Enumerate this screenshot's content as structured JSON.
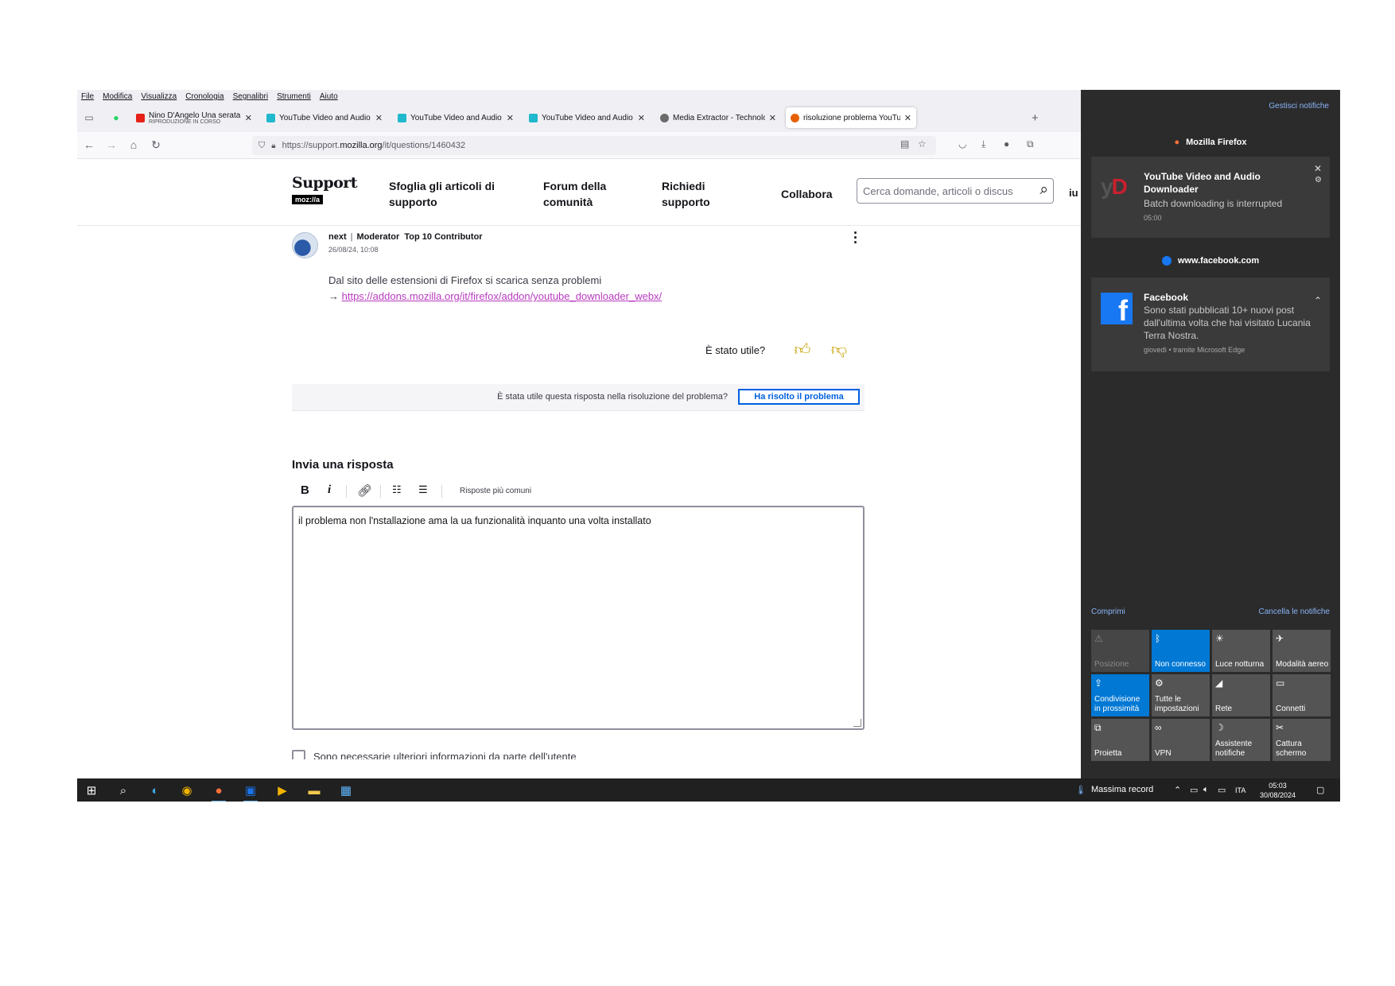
{
  "menu": [
    "File",
    "Modifica",
    "Visualizza",
    "Cronologia",
    "Segnalibri",
    "Strumenti",
    "Aiuto"
  ],
  "tabs": [
    {
      "title": "Nino D'Angelo Una serata parti",
      "subtitle": "RIPRODUZIONE IN CORSO",
      "color": "#e62117",
      "active": false
    },
    {
      "title": "YouTube Video and Audio Dow",
      "color": "#1fb8cd",
      "active": false
    },
    {
      "title": "YouTube Video and Audio Dow",
      "color": "#1fb8cd",
      "active": false
    },
    {
      "title": "YouTube Video and Audio Dow",
      "color": "#1fb8cd",
      "active": false
    },
    {
      "title": "Media Extractor - TechnologyTo",
      "color": "#6b6b6b",
      "active": false
    },
    {
      "title": "risoluzione problema YouTube",
      "color": "#e66000",
      "active": true
    }
  ],
  "url": {
    "prefix": "https://support.",
    "domain": "mozilla.org",
    "path": "/it/questions/1460432"
  },
  "sumo": {
    "logo_text": "Support",
    "logo_badge": "moz://a",
    "nav": [
      "Sfoglia gli articoli di supporto",
      "Forum della comunità",
      "Richiedi supporto",
      "Collabora"
    ],
    "search_placeholder": "Cerca domande, articoli o discus",
    "cut_nav": "iu"
  },
  "post": {
    "author": "next",
    "role": "Moderator",
    "badge": "Top 10 Contributor",
    "date": "26/08/24, 10:08",
    "text": "Dal sito delle estensioni di Firefox si scarica senza problemi",
    "arrow": "→",
    "link": "https://addons.mozilla.org/it/firefox/addon/youtube_downloader_webx/",
    "helpful_q": "È stato utile?"
  },
  "solved": {
    "question": "È stata utile questa risposta nella risoluzione del problema?",
    "button": "Ha risolto il problema"
  },
  "reply": {
    "title": "Invia una risposta",
    "common_responses": "Risposte più comuni",
    "text": "il problema non l'nstallazione ama la ua funzionalità inquanto una volta installato",
    "more_info": "Sono necessarie ulteriori informazioni da parte dell'utente"
  },
  "action_center": {
    "manage": "Gestisci notifiche",
    "firefox_group": "Mozilla Firefox",
    "yd_title": "YouTube Video and Audio Downloader",
    "yd_msg": "Batch downloading is interrupted",
    "yd_time": "05:00",
    "fb_group": "www.facebook.com",
    "fb_title": "Facebook",
    "fb_msg": "Sono stati pubblicati 10+ nuovi post dall'ultima volta che hai visitato Lucania Terra Nostra.",
    "fb_meta": "giovedì • tramite Microsoft Edge",
    "collapse": "Comprimi",
    "clear": "Cancella le notifiche",
    "tiles": [
      {
        "label": "Posizione",
        "icon": "location-icon",
        "state": "dim"
      },
      {
        "label": "Non connesso",
        "icon": "bluetooth-icon",
        "state": "on"
      },
      {
        "label": "Luce notturna",
        "icon": "night-light-icon",
        "state": "off"
      },
      {
        "label": "Modalità aereo",
        "icon": "airplane-icon",
        "state": "off"
      },
      {
        "label": "Condivisione in prossimità",
        "icon": "nearby-share-icon",
        "state": "on"
      },
      {
        "label": "Tutte le impostazioni",
        "icon": "settings-icon",
        "state": "off"
      },
      {
        "label": "Rete",
        "icon": "network-icon",
        "state": "off"
      },
      {
        "label": "Connetti",
        "icon": "connect-icon",
        "state": "off"
      },
      {
        "label": "Proietta",
        "icon": "project-icon",
        "state": "off"
      },
      {
        "label": "VPN",
        "icon": "vpn-icon",
        "state": "off"
      },
      {
        "label": "Assistente notifiche",
        "icon": "focus-assist-icon",
        "state": "off"
      },
      {
        "label": "Cattura schermo",
        "icon": "screen-snip-icon",
        "state": "off"
      }
    ]
  },
  "taskbar": {
    "weather": "Massima record",
    "lang": "ITA",
    "time": "05:03",
    "date": "30/08/2024"
  }
}
